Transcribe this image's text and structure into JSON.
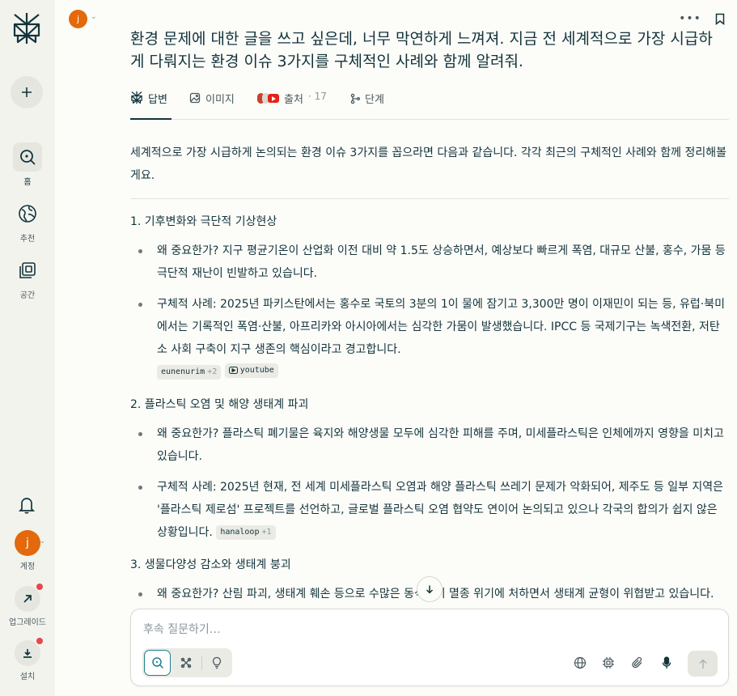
{
  "user": {
    "initial": "j"
  },
  "sidebar": {
    "items": [
      {
        "label": "홈",
        "icon": "search-icon"
      },
      {
        "label": "추천",
        "icon": "globe-icon"
      },
      {
        "label": "공간",
        "icon": "spaces-icon"
      }
    ],
    "account_label": "계정",
    "upgrade_label": "업그레이드",
    "install_label": "설치"
  },
  "thread": {
    "question": "환경 문제에 대한 글을 쓰고 싶은데, 너무 막연하게 느껴져. 지금 전 세계적으로 가장 시급하게 다뤄지는 환경 이슈 3가지를 구체적인 사례와 함께 알려줘.",
    "tabs": [
      {
        "label": "답변",
        "active": true
      },
      {
        "label": "이미지"
      },
      {
        "label": "출처",
        "count": "17"
      },
      {
        "label": "단계"
      }
    ]
  },
  "answer": {
    "intro": "세계적으로 가장 시급하게 논의되는 환경 이슈 3가지를 꼽으라면 다음과 같습니다. 각각 최근의 구체적인 사례와 함께 정리해볼게요.",
    "sections": [
      {
        "title": "1. 기후변화와 극단적 기상현상",
        "bullets": [
          "왜 중요한가? 지구 평균기온이 산업화 이전 대비 약 1.5도 상승하면서, 예상보다 빠르게 폭염, 대규모 산불, 홍수, 가뭄 등 극단적 재난이 빈발하고 있습니다.",
          "구체적 사례: 2025년 파키스탄에서는 홍수로 국토의 3분의 1이 물에 잠기고 3,300만 명이 이재민이 되는 등, 유럽·북미에서는 기록적인 폭염·산불, 아프리카와 아시아에서는 심각한 가뭄이 발생했습니다. IPCC 등 국제기구는 녹색전환, 저탄소 사회 구축이 지구 생존의 핵심이라고 경고합니다."
        ],
        "citations": [
          {
            "name": "eunenurim",
            "more": "+2"
          },
          {
            "name": "youtube",
            "more": ""
          }
        ]
      },
      {
        "title": "2. 플라스틱 오염 및 해양 생태계 파괴",
        "bullets": [
          "왜 중요한가? 플라스틱 폐기물은 육지와 해양생물 모두에 심각한 피해를 주며, 미세플라스틱은 인체에까지 영향을 미치고 있습니다.",
          "구체적 사례: 2025년 현재, 전 세계 미세플라스틱 오염과 해양 플라스틱 쓰레기 문제가 악화되어, 제주도 등 일부 지역은 '플라스틱 제로섬' 프로젝트를 선언하고, 글로벌 플라스틱 오염 협약도 연이어 논의되고 있으나 각국의 합의가 쉽지 않은 상황입니다."
        ],
        "citations": [
          {
            "name": "hanaloop",
            "more": "+1"
          }
        ]
      },
      {
        "title": "3. 생물다양성 감소와 생태계 붕괴",
        "bullets": [
          "왜 중요한가? 산림 파괴, 생태계 훼손 등으로 수많은 동식물이 멸종 위기에 처하면서 생태계 균형이 위협받고 있습니다."
        ]
      }
    ]
  },
  "composer": {
    "placeholder": "후속 질문하기…"
  },
  "colors": {
    "accent": "#20808d",
    "avatar": "#e3690c",
    "notification": "#e5484d"
  }
}
